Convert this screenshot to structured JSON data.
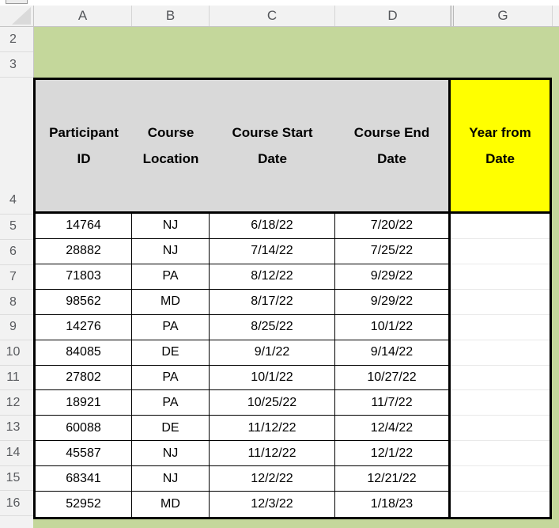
{
  "spreadsheet": {
    "column_headers": [
      "A",
      "B",
      "C",
      "D",
      "G"
    ],
    "row_numbers": [
      "2",
      "3",
      "4",
      "5",
      "6",
      "7",
      "8",
      "9",
      "10",
      "11",
      "12",
      "13",
      "14",
      "15",
      "16"
    ]
  },
  "colors": {
    "band_green": "#c4d79b",
    "header_gray": "#d9d9d9",
    "highlight_yellow": "#ffff00"
  },
  "sheet_table": {
    "headers": {
      "participant_id": "Participant\nID",
      "location": "Course\nLocation",
      "start": "Course Start\nDate",
      "end": "Course End\nDate",
      "year_from_date": "Year from\nDate"
    },
    "rows": [
      {
        "participant_id": "14764",
        "location": "NJ",
        "start": "6/18/22",
        "end": "7/20/22",
        "year_from_date": ""
      },
      {
        "participant_id": "28882",
        "location": "NJ",
        "start": "7/14/22",
        "end": "7/25/22",
        "year_from_date": ""
      },
      {
        "participant_id": "71803",
        "location": "PA",
        "start": "8/12/22",
        "end": "9/29/22",
        "year_from_date": ""
      },
      {
        "participant_id": "98562",
        "location": "MD",
        "start": "8/17/22",
        "end": "9/29/22",
        "year_from_date": ""
      },
      {
        "participant_id": "14276",
        "location": "PA",
        "start": "8/25/22",
        "end": "10/1/22",
        "year_from_date": ""
      },
      {
        "participant_id": "84085",
        "location": "DE",
        "start": "9/1/22",
        "end": "9/14/22",
        "year_from_date": ""
      },
      {
        "participant_id": "27802",
        "location": "PA",
        "start": "10/1/22",
        "end": "10/27/22",
        "year_from_date": ""
      },
      {
        "participant_id": "18921",
        "location": "PA",
        "start": "10/25/22",
        "end": "11/7/22",
        "year_from_date": ""
      },
      {
        "participant_id": "60088",
        "location": "DE",
        "start": "11/12/22",
        "end": "12/4/22",
        "year_from_date": ""
      },
      {
        "participant_id": "45587",
        "location": "NJ",
        "start": "11/12/22",
        "end": "12/1/22",
        "year_from_date": ""
      },
      {
        "participant_id": "68341",
        "location": "NJ",
        "start": "12/2/22",
        "end": "12/21/22",
        "year_from_date": ""
      },
      {
        "participant_id": "52952",
        "location": "MD",
        "start": "12/3/22",
        "end": "1/18/23",
        "year_from_date": ""
      }
    ]
  }
}
